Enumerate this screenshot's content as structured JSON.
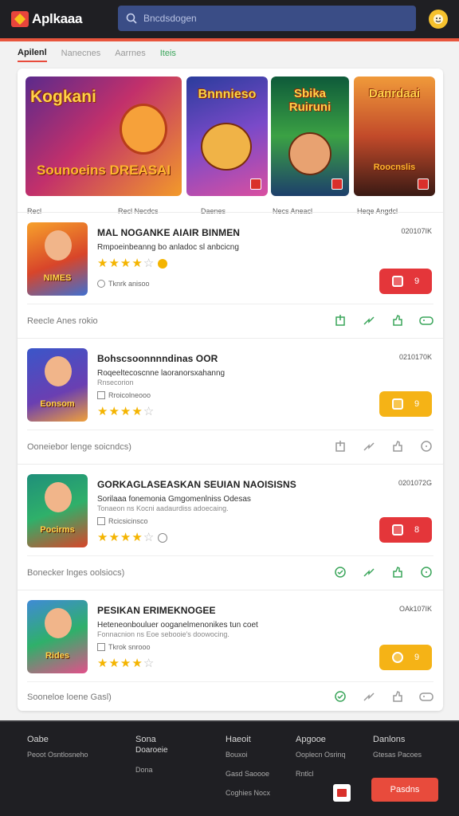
{
  "header": {
    "logo_text": "Aplkaaa",
    "search_placeholder": "Bncdsdogen",
    "accent": "#e8553d"
  },
  "tabs": [
    {
      "label": "Apilenl",
      "active": true
    },
    {
      "label": "Nanecnes",
      "active": false
    },
    {
      "label": "Aarrnes",
      "active": false
    },
    {
      "label": "Iteis",
      "active": false
    }
  ],
  "carousel": [
    {
      "title": "Kogkani",
      "subtitle": "Sounoeins DREASAI",
      "caption": "Recl"
    },
    {
      "title": "",
      "subtitle": "",
      "caption": "Recl Necdcs"
    },
    {
      "title": "Bnnnieso",
      "subtitle": "",
      "caption": "Daenes"
    },
    {
      "title": "Sbika Ruiruni",
      "subtitle": "",
      "caption": "Necs Aneacl"
    },
    {
      "title": "Danrdaai",
      "subtitle": "Roocnslis",
      "caption": "Heqe Angdcl"
    }
  ],
  "apps": [
    {
      "title": "MAL NOGANKE AIAIR BINMEN",
      "date": "020107IK",
      "desc": "Rmpoeinbeanng bo anladoc sl anbcicng",
      "desc2": "",
      "meta": "Tknrk anisoo",
      "rating": 3.5,
      "icon_label": "NIMES",
      "action_color": "red",
      "action_label": "9",
      "footer": "Reecle Anes   rokio"
    },
    {
      "title": "Bohscsoonnnndinas OOR",
      "date": "0210170K",
      "desc": "Roqeeltecoscnne laoranorsxahanng",
      "desc2": "Rnsecorion",
      "meta": "Rroicolneooo",
      "rating": 4.5,
      "icon_label": "Eonsom",
      "action_color": "yellow",
      "action_label": "9",
      "footer": "Ooneiebor lenge soicndcs)"
    },
    {
      "title": "GORKAGLASEASKAN SEUIAN NAOISISNS",
      "date": "0201072G",
      "desc": "Sorilaaa fonemonia Gmgomenlniss Odesas",
      "desc2": "Tonaeon ns Kocni aadaurdiss adoecaing.",
      "meta": "Rcicsicinsco",
      "rating": 3.5,
      "icon_label": "Pocirms",
      "action_color": "red",
      "action_label": "8",
      "footer": "Bonecker lnges oolsiocs)"
    },
    {
      "title": "PESIKAN ERIMEKNOGEE",
      "date": "OAk107IK",
      "desc": "Heteneonbouluer ooganelmenonikes tun coet",
      "desc2": "Fonnacnion ns Eoe sebooie's doowocing.",
      "meta": "Tkrok snrooo",
      "rating": 4.5,
      "icon_label": "Rides",
      "action_color": "yellow",
      "action_label": "9",
      "footer": "Sooneloe loene Gasl)"
    }
  ],
  "footer": {
    "columns": [
      {
        "head": "Oabe",
        "links": [
          "Peoot Osntlosneho"
        ]
      },
      {
        "head": "Sona",
        "links": [
          "Doaroeie",
          "Dona"
        ]
      },
      {
        "head": "Haeoit",
        "links": [
          "Bouxoi",
          "Gasd Saoooe",
          "Coghies Nocx"
        ]
      },
      {
        "head": "Apgooe",
        "links": [
          "Ooplecn Osrinq",
          "Rntlcl"
        ]
      },
      {
        "head": "Danlons",
        "links": [
          "Gtesas Pacoes"
        ]
      }
    ],
    "cta_label": "Pasdns"
  },
  "colors": {
    "red_action": "#e4363a",
    "yellow_action": "#f5b316",
    "star": "#f4b400",
    "footer_bg": "#1f1f23"
  }
}
